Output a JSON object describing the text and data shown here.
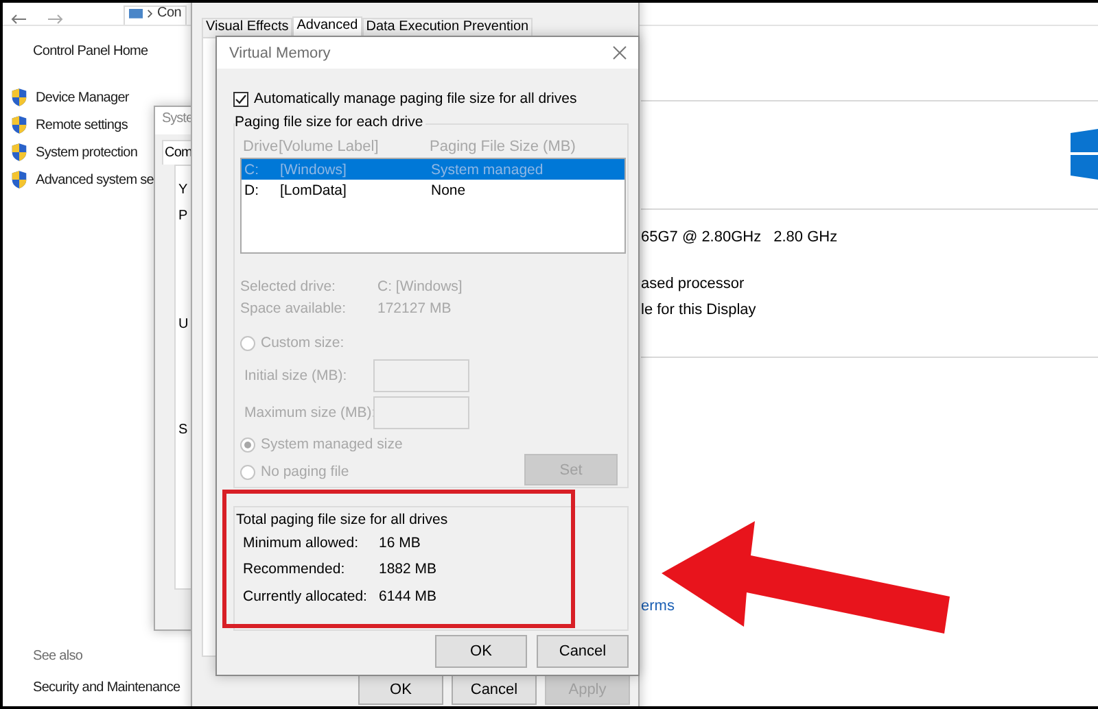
{
  "explorer": {
    "address": "Con",
    "home_link": "Control Panel Home",
    "tasks": [
      "Device Manager",
      "Remote settings",
      "System protection",
      "Advanced system se"
    ],
    "see_also": {
      "heading": "See also",
      "links": [
        "Security and Maintenance"
      ]
    },
    "processor": [
      "65G7 @ 2.80GHz",
      "2.80 GHz"
    ],
    "details": [
      "ased processor",
      "le for this Display"
    ],
    "link": "erms"
  },
  "system_properties": {
    "title": "Syste",
    "tabs": [
      {
        "label": "Com",
        "selected": true
      }
    ],
    "fragments": [
      "Y",
      "P",
      "U",
      "S"
    ]
  },
  "performance_options": {
    "tabs": [
      {
        "label": "Visual Effects",
        "selected": false
      },
      {
        "label": "Advanced",
        "selected": true
      },
      {
        "label": "Data Execution Prevention",
        "selected": false
      }
    ],
    "buttons": [
      {
        "label": "OK",
        "disabled": false
      },
      {
        "label": "Cancel",
        "disabled": false
      },
      {
        "label": "Apply",
        "disabled": true
      }
    ]
  },
  "virtual_memory": {
    "title": "Virtual Memory",
    "auto_manage": {
      "label": "Automatically manage paging file size for all drives",
      "checked": true
    },
    "drives": {
      "title": "Paging file size for each drive",
      "disabled": true,
      "columns": [
        "Drive",
        "[Volume Label]",
        "Paging File Size (MB)"
      ],
      "rows": [
        {
          "drive": "C:",
          "label": "[Windows]",
          "size": "System managed",
          "selected": true
        },
        {
          "drive": "D:",
          "label": "[LomData]",
          "size": "None",
          "selected": false
        }
      ],
      "info": [
        {
          "label": "Selected drive:",
          "value": "C:  [Windows]"
        },
        {
          "label": "Space available:",
          "value": "172127 MB"
        }
      ],
      "options": [
        {
          "kind": "radio",
          "label": "Custom size:",
          "selected": false
        },
        {
          "kind": "field",
          "label": "Initial size (MB):"
        },
        {
          "kind": "field",
          "label": "Maximum size (MB):"
        },
        {
          "kind": "radio",
          "label": "System managed size",
          "selected": true
        },
        {
          "kind": "radio",
          "label": "No paging file",
          "selected": false
        }
      ],
      "set_button": {
        "label": "Set",
        "disabled": true
      }
    },
    "totals": {
      "title": "Total paging file size for all drives",
      "rows": [
        {
          "label": "Minimum allowed:",
          "value": "16 MB"
        },
        {
          "label": "Recommended:",
          "value": "1882 MB"
        },
        {
          "label": "Currently allocated:",
          "value": "6144 MB"
        }
      ]
    },
    "buttons": [
      {
        "label": "OK",
        "disabled": false
      },
      {
        "label": "Cancel",
        "disabled": false
      }
    ]
  }
}
